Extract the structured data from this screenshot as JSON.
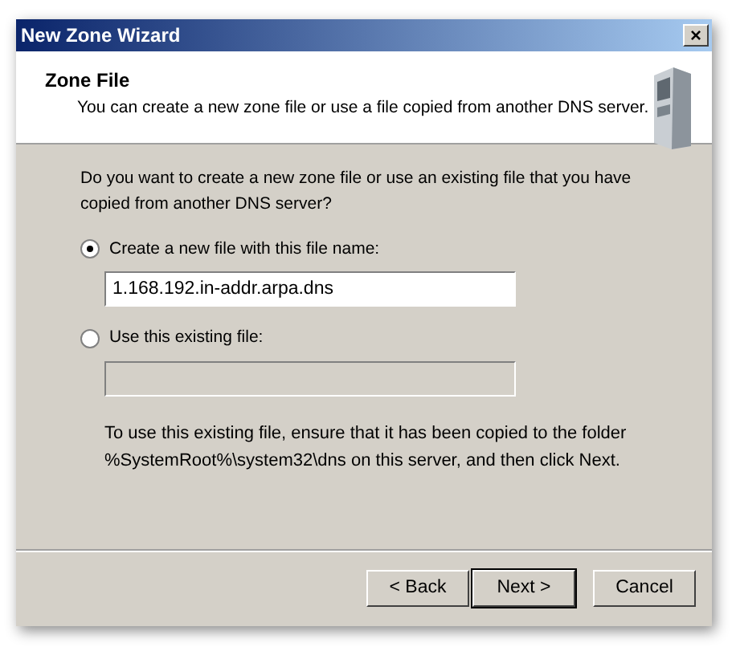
{
  "window": {
    "title": "New Zone Wizard",
    "close": "×"
  },
  "header": {
    "title": "Zone File",
    "subtitle": "You can create a new zone file or use a file copied from another DNS server."
  },
  "question": "Do you want to create a new zone file or use an existing file that you have copied from another DNS server?",
  "options": [
    {
      "label": "Create a new file with this file name:",
      "selected": true,
      "field": {
        "value": "1.168.192.in-addr.arpa.dns",
        "disabled": false
      }
    },
    {
      "label": "Use this existing file:",
      "selected": false,
      "field": {
        "disabled": true
      }
    }
  ],
  "note": "To use this existing file, ensure that it has been copied to the folder %SystemRoot%\\system32\\dns on this server, and then click Next.",
  "buttons": [
    {
      "label": "< Back",
      "default": false
    },
    {
      "label": "Next >",
      "default": true
    },
    {
      "label": "Cancel",
      "default": false
    }
  ]
}
